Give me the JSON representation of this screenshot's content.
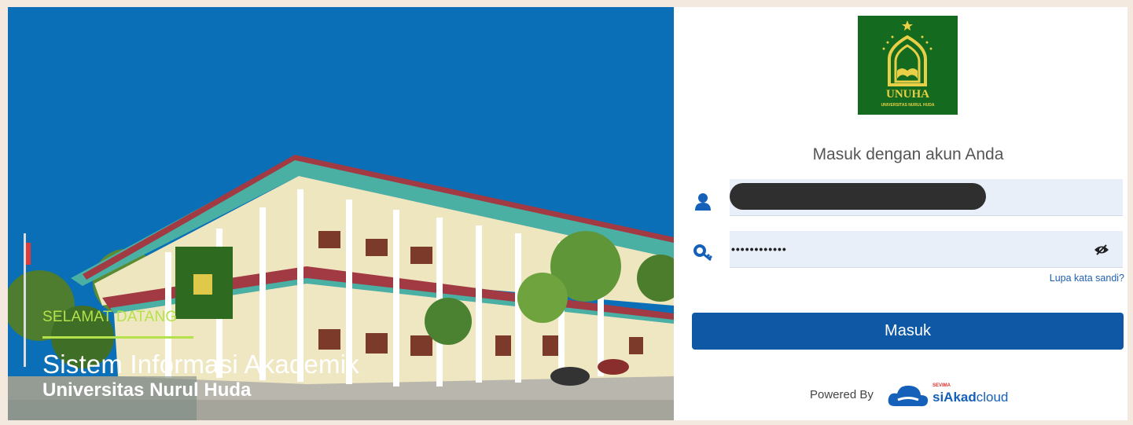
{
  "hero": {
    "welcome": "SELAMAT DATANG",
    "system_title": "Sistem Informasi Akademik",
    "university": "Universitas Nurul Huda"
  },
  "logo": {
    "text": "UNUHA",
    "subtext": "UNIVERSITAS NURUL HUDA"
  },
  "login": {
    "heading": "Masuk dengan akun Anda",
    "username_value": "",
    "password_value": "••••••••••••",
    "forgot_label": "Lupa kata sandi?",
    "submit_label": "Masuk"
  },
  "footer": {
    "powered_by": "Powered By",
    "brand_name": "siAkad",
    "brand_suffix": "cloud",
    "brand_small": "SEVIMA"
  },
  "colors": {
    "hero_blue": "#0a6fb6",
    "accent_green": "#b5e24a",
    "button_blue": "#0e58a6",
    "logo_green": "#146b1f",
    "logo_gold": "#e9cf45"
  },
  "icons": [
    "user-icon",
    "key-icon",
    "eye-slash-icon",
    "cloud-logo-icon"
  ]
}
